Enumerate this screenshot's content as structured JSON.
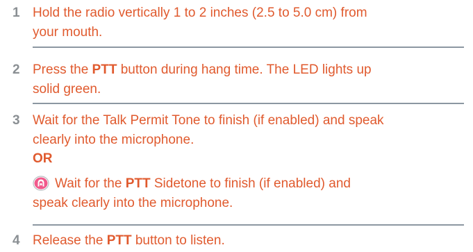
{
  "steps": [
    {
      "number": "1",
      "line1": "Hold the radio vertically 1 to 2 inches (2.5 to 5.0 cm) from",
      "line2": "your mouth."
    },
    {
      "number": "2",
      "line1_a": "Press the ",
      "line1_bold": "PTT",
      "line1_b": " button during hang time. The LED lights up",
      "line2": "solid green."
    },
    {
      "number": "3",
      "line1": "Wait for the Talk Permit Tone to finish (if enabled) and speak",
      "line2": "clearly into the microphone.",
      "or_label": "OR",
      "alt_line1_a": "Wait for the ",
      "alt_line1_bold": "PTT",
      "alt_line1_b": " Sidetone to finish (if enabled) and",
      "alt_line2": "speak clearly into the microphone.",
      "alt_icon": "sidetone-icon"
    },
    {
      "number": "4",
      "line1_a": "Release the ",
      "line1_bold": "PTT",
      "line1_b": " button to listen."
    }
  ],
  "colors": {
    "text": "#e05a2e",
    "number": "#8a8f93",
    "divider": "#8c97a1",
    "icon_fill": "#f15a8c"
  }
}
